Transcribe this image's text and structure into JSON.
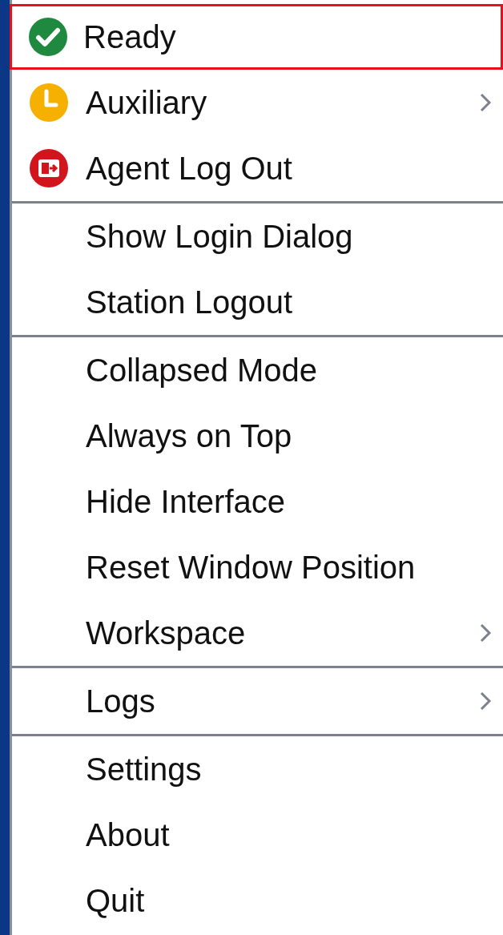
{
  "menu": {
    "items": [
      {
        "kind": "item",
        "label": "Ready",
        "color": "#1f8a3f",
        "selected": true,
        "has_submenu": false
      },
      {
        "kind": "item",
        "label": "Auxiliary",
        "color": "#f5b000",
        "selected": false,
        "has_submenu": true
      },
      {
        "kind": "item",
        "label": "Agent Log Out",
        "color": "#d2141c",
        "selected": false,
        "has_submenu": false
      },
      {
        "kind": "separator"
      },
      {
        "kind": "item",
        "label": "Show Login Dialog",
        "selected": false,
        "has_submenu": false
      },
      {
        "kind": "item",
        "label": "Station Logout",
        "selected": false,
        "has_submenu": false
      },
      {
        "kind": "separator"
      },
      {
        "kind": "item",
        "label": "Collapsed Mode",
        "selected": false,
        "has_submenu": false
      },
      {
        "kind": "item",
        "label": "Always on Top",
        "selected": false,
        "has_submenu": false
      },
      {
        "kind": "item",
        "label": "Hide Interface",
        "selected": false,
        "has_submenu": false
      },
      {
        "kind": "item",
        "label": "Reset Window Position",
        "selected": false,
        "has_submenu": false
      },
      {
        "kind": "item",
        "label": "Workspace",
        "selected": false,
        "has_submenu": true
      },
      {
        "kind": "separator"
      },
      {
        "kind": "item",
        "label": "Logs",
        "selected": false,
        "has_submenu": true
      },
      {
        "kind": "separator"
      },
      {
        "kind": "item",
        "label": "Settings",
        "selected": false,
        "has_submenu": false
      },
      {
        "kind": "item",
        "label": "About",
        "selected": false,
        "has_submenu": false
      },
      {
        "kind": "item",
        "label": "Quit",
        "selected": false,
        "has_submenu": false
      }
    ]
  }
}
